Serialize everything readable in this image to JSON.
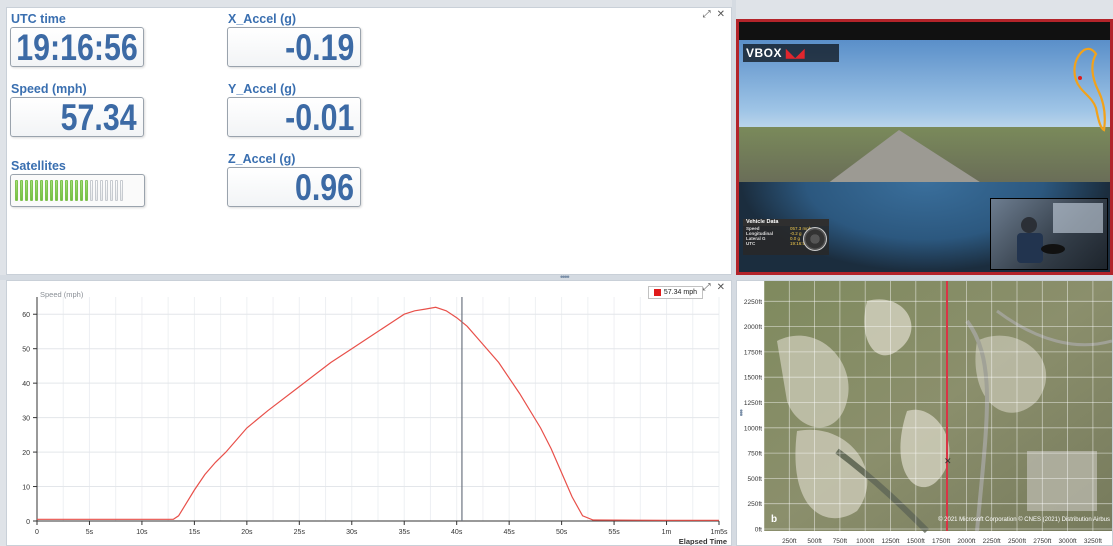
{
  "gauges": {
    "utc_time": {
      "label": "UTC time",
      "value": "19:16:56"
    },
    "speed": {
      "label": "Speed (mph)",
      "value": "57.34"
    },
    "satellites": {
      "label": "Satellites",
      "filled": 15,
      "total": 22
    },
    "x_accel": {
      "label": "X_Accel (g)",
      "value": "-0.19"
    },
    "y_accel": {
      "label": "Y_Accel (g)",
      "value": "-0.01"
    },
    "z_accel": {
      "label": "Z_Accel (g)",
      "value": "0.96"
    }
  },
  "window_controls": {
    "expand": "⤢",
    "close": "✕"
  },
  "video": {
    "logo_text": "VBOX",
    "vehicle_data": {
      "title": "Vehicle Data",
      "rows": [
        {
          "key": "Speed",
          "value": "057.3 mph"
        },
        {
          "key": "Longitudinal",
          "value": "-0.2 g"
        },
        {
          "key": "Lateral G",
          "value": "0.0 g"
        },
        {
          "key": "UTC",
          "value": "19:16:56.30"
        }
      ]
    }
  },
  "chart_legend": {
    "label": "57.34 mph",
    "color": "#e01b1b"
  },
  "chart_data": {
    "type": "line",
    "ylabel": "Speed (mph)",
    "xlabel": "Elapsed Time",
    "ylim": [
      0,
      65
    ],
    "xlim": [
      0,
      65
    ],
    "y_ticks": [
      0,
      10,
      20,
      30,
      40,
      50,
      60
    ],
    "x_ticks": [
      {
        "v": 0,
        "label": "0"
      },
      {
        "v": 5,
        "label": "5s"
      },
      {
        "v": 10,
        "label": "10s"
      },
      {
        "v": 15,
        "label": "15s"
      },
      {
        "v": 20,
        "label": "20s"
      },
      {
        "v": 25,
        "label": "25s"
      },
      {
        "v": 30,
        "label": "30s"
      },
      {
        "v": 35,
        "label": "35s"
      },
      {
        "v": 40,
        "label": "40s"
      },
      {
        "v": 45,
        "label": "45s"
      },
      {
        "v": 50,
        "label": "50s"
      },
      {
        "v": 55,
        "label": "55s"
      },
      {
        "v": 60,
        "label": "1m"
      },
      {
        "v": 65,
        "label": "1m5s"
      }
    ],
    "cursor_x": 40.5,
    "grid": true,
    "series": [
      {
        "color": "#e8504a",
        "x": [
          0,
          13,
          13.5,
          14,
          15,
          16,
          17,
          18,
          20,
          22,
          25,
          28,
          30,
          32,
          34,
          35,
          36,
          37,
          38,
          39,
          40,
          41,
          42,
          44,
          46,
          48,
          49,
          50,
          51,
          52,
          53,
          60,
          65
        ],
        "y": [
          0.5,
          0.5,
          1.5,
          4,
          9,
          13.5,
          17,
          20,
          27,
          32,
          39,
          46,
          50,
          54,
          58,
          60,
          61,
          61.5,
          62,
          61,
          59,
          56.5,
          53,
          46,
          37,
          27,
          21,
          14,
          7,
          1.5,
          0.3,
          0.2,
          0.2
        ]
      }
    ]
  },
  "map": {
    "y_ticks": [
      "2250ft",
      "2000ft",
      "1750ft",
      "1500ft",
      "1250ft",
      "1000ft",
      "750ft",
      "500ft",
      "250ft",
      "0ft"
    ],
    "x_ticks": [
      "250ft",
      "500ft",
      "750ft",
      "1000ft",
      "1250ft",
      "1500ft",
      "1750ft",
      "2000ft",
      "2250ft",
      "2500ft",
      "2750ft",
      "3000ft",
      "3250ft"
    ],
    "attribution": "© 2021 Microsoft Corporation © CNES (2021) Distribution Airbus"
  }
}
